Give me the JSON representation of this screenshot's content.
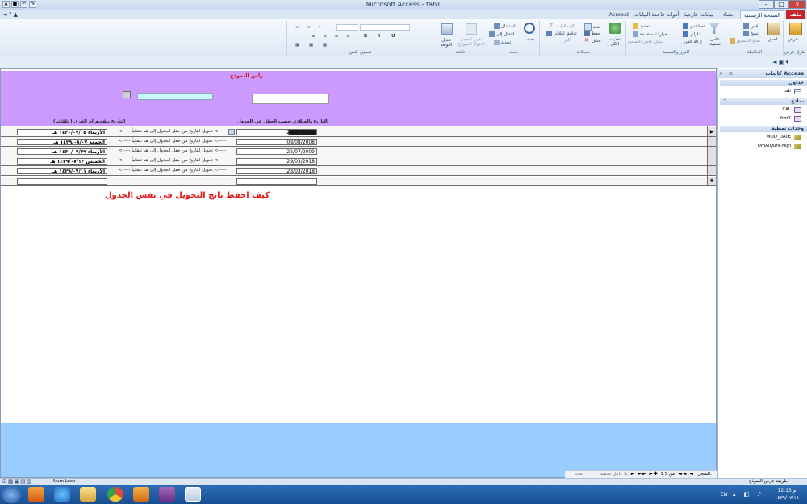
{
  "window": {
    "title": "Microsoft Access - tab1",
    "minimize": "–",
    "maximize": "□",
    "close": "x"
  },
  "tabs": [
    "ملف",
    "الصفحة الرئيسية",
    "إنشاء",
    "بيانات خارجية",
    "أدوات قاعدة البيانات",
    "Acrobat"
  ],
  "ribbon": {
    "groups": [
      {
        "name": "طرق عرض",
        "items": [
          "عرض"
        ]
      },
      {
        "name": "الحافظة",
        "items": [
          "لصق",
          "قص",
          "نسخ",
          "نسخ التنسيق"
        ]
      },
      {
        "name": "الفرز والتصفية",
        "items": [
          "عامل تصفية",
          "تصاعدي",
          "تنازلي",
          "إزالة الفرز",
          "تحديد",
          "خيارات متقدمة",
          "تبديل عامل التصفية"
        ]
      },
      {
        "name": "سجلات",
        "items": [
          "تحديث الكل",
          "جديد",
          "حفظ",
          "حذف",
          "الإجماليات",
          "تدقيق إملائي",
          "أكثر"
        ]
      },
      {
        "name": "بحث",
        "items": [
          "بحث",
          "استبدال",
          "انتقال إلى",
          "تحديد"
        ]
      },
      {
        "name": "نافذة",
        "items": [
          "تبديل النوافذ",
          "احتواء النموذج",
          "تغيير الحجم"
        ]
      },
      {
        "name": "تنسيق النص",
        "items": []
      }
    ]
  },
  "nav": {
    "title": "كائنات Access",
    "sections": [
      {
        "name": "جداول",
        "items": [
          "tab"
        ]
      },
      {
        "name": "نماذج",
        "items": [
          "CAL",
          "frm1"
        ]
      },
      {
        "name": "وحدات نمطية",
        "items": [
          "MOD_DATE",
          "UmAlQura-Hijri"
        ]
      }
    ]
  },
  "form": {
    "header_title": "رأس النموذج",
    "col_gregorian": "التاريخ بالميلادي حسب الحقل في الجدول",
    "col_hijri": "التاريخ بتقويم أم القرى ( تلقائيا)",
    "arrow_text": "<----- تحويل التاريخ من حقل الجدول إلى هنا تلقائياً <-----",
    "question": "كيف احفظ ناتج التحويل في نفس الجدول",
    "rows": [
      {
        "gregorian": "28/07/2009",
        "hijri": "الأربعاء ١٤٣٠/٠٧/١٥ هـ"
      },
      {
        "gregorian": "08/08/2008",
        "hijri": "الجمعة ١٤٢٩/٠٨/٠٧ هـ"
      },
      {
        "gregorian": "22/07/2009",
        "hijri": "الأربعاء ١٤٣٠/٠٧/٢٩ هـ"
      },
      {
        "gregorian": "29/03/2018",
        "hijri": "الخميس ١٤٢٩/٠٧/١٢ هـ"
      },
      {
        "gregorian": "28/03/2018",
        "hijri": "الأربعاء ١٤٢٩/٠٧/١١ هـ"
      }
    ]
  },
  "status": {
    "record_label": "السجل:",
    "record_value": "1 من 5",
    "no_filter": "بلا عامل تصفية",
    "search": "بحث",
    "left_text": "Num Lock",
    "right_text": "طريقة عرض النموذج"
  },
  "taskbar": {
    "lang": "EN",
    "time": "12:13 م",
    "date": "١٤٣٩/٠٧/١٤"
  }
}
